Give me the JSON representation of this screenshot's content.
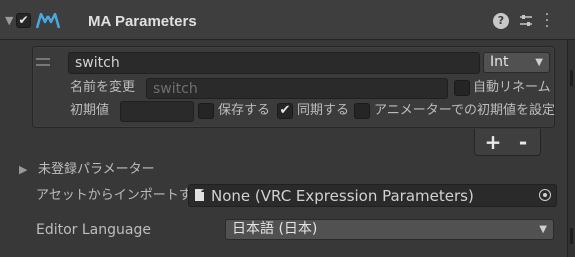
{
  "header": {
    "title": "MA Parameters",
    "component_enabled": true,
    "icons": [
      "chevron-down-icon",
      "modular-avatar-icon",
      "help-icon",
      "preset-icon",
      "kebab-menu-icon"
    ]
  },
  "parameter": {
    "name": "switch",
    "type": "Int",
    "rename_label": "名前を変更",
    "rename_placeholder": "switch",
    "auto_rename_label": "自動リネーム",
    "auto_rename_checked": false,
    "default_label": "初期値",
    "default_value": "",
    "saved_label": "保存する",
    "saved_checked": false,
    "synced_label": "同期する",
    "synced_checked": true,
    "anim_default_label": "アニメーターでの初期値を設定",
    "anim_default_checked": false
  },
  "list_buttons": {
    "add": "+",
    "remove": "-"
  },
  "unregistered": {
    "label": "未登録パラメーター"
  },
  "import": {
    "label": "アセットからインポートする",
    "value": "None (VRC Expression Parameters)"
  },
  "language": {
    "label": "Editor Language",
    "value": "日本語 (日本)"
  },
  "colors": {
    "background": "#383838",
    "header": "#3e3e3e",
    "field": "#2a2a2a",
    "accent_icon": "#4aa8e0"
  }
}
